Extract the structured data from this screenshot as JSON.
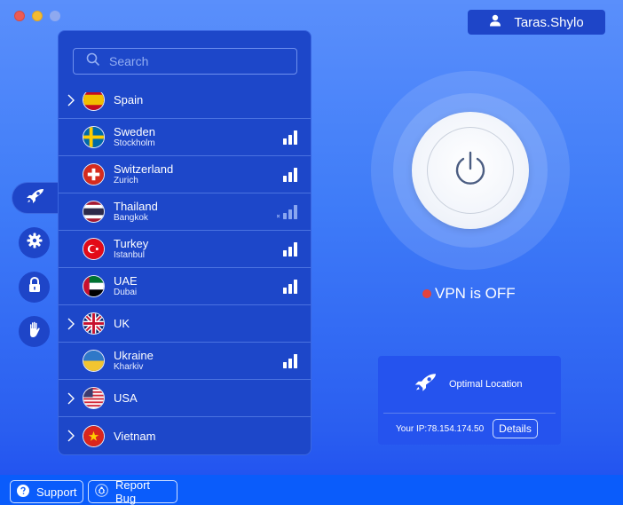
{
  "window": {
    "controls": [
      "close",
      "minimize",
      "maximize"
    ]
  },
  "user": {
    "name": "Taras.Shylo",
    "icon": "user-icon"
  },
  "search": {
    "placeholder": "Search",
    "icon": "search-icon"
  },
  "countries": [
    {
      "name": "Spain",
      "city": "",
      "expandable": true,
      "flag": "spain",
      "signal": null
    },
    {
      "name": "Sweden",
      "city": "Stockholm",
      "expandable": false,
      "flag": "sweden",
      "signal": "good"
    },
    {
      "name": "Switzerland",
      "city": "Zurich",
      "expandable": false,
      "flag": "switzerland",
      "signal": "good"
    },
    {
      "name": "Thailand",
      "city": "Bangkok",
      "expandable": false,
      "flag": "thailand",
      "signal": "unavailable"
    },
    {
      "name": "Turkey",
      "city": "Istanbul",
      "expandable": false,
      "flag": "turkey",
      "signal": "good"
    },
    {
      "name": "UAE",
      "city": "Dubai",
      "expandable": false,
      "flag": "uae",
      "signal": "good"
    },
    {
      "name": "UK",
      "city": "",
      "expandable": true,
      "flag": "uk",
      "signal": null
    },
    {
      "name": "Ukraine",
      "city": "Kharkiv",
      "expandable": false,
      "flag": "ukraine",
      "signal": "good"
    },
    {
      "name": "USA",
      "city": "",
      "expandable": true,
      "flag": "usa",
      "signal": null
    },
    {
      "name": "Vietnam",
      "city": "",
      "expandable": true,
      "flag": "vietnam",
      "signal": null
    }
  ],
  "sidebar": {
    "items": [
      {
        "id": "quick-connect",
        "icon": "rocket-icon",
        "active": true
      },
      {
        "id": "settings",
        "icon": "gear-icon",
        "active": false
      },
      {
        "id": "security",
        "icon": "lock-icon",
        "active": false
      },
      {
        "id": "privacy",
        "icon": "hand-icon",
        "active": false
      }
    ]
  },
  "vpn": {
    "status_text": "VPN is OFF",
    "status_color": "#e4433d",
    "connected": false
  },
  "location_card": {
    "label": "Optimal Location",
    "ip_label": "Your IP:",
    "ip_value": "78.154.174.50",
    "details_label": "Details"
  },
  "footer": {
    "support_label": "Support",
    "report_bug_label": "Report Bug"
  },
  "colors": {
    "accent": "#1e45c8",
    "panel": "#1d47c9",
    "bottom_bar": "#0a5cfb"
  }
}
